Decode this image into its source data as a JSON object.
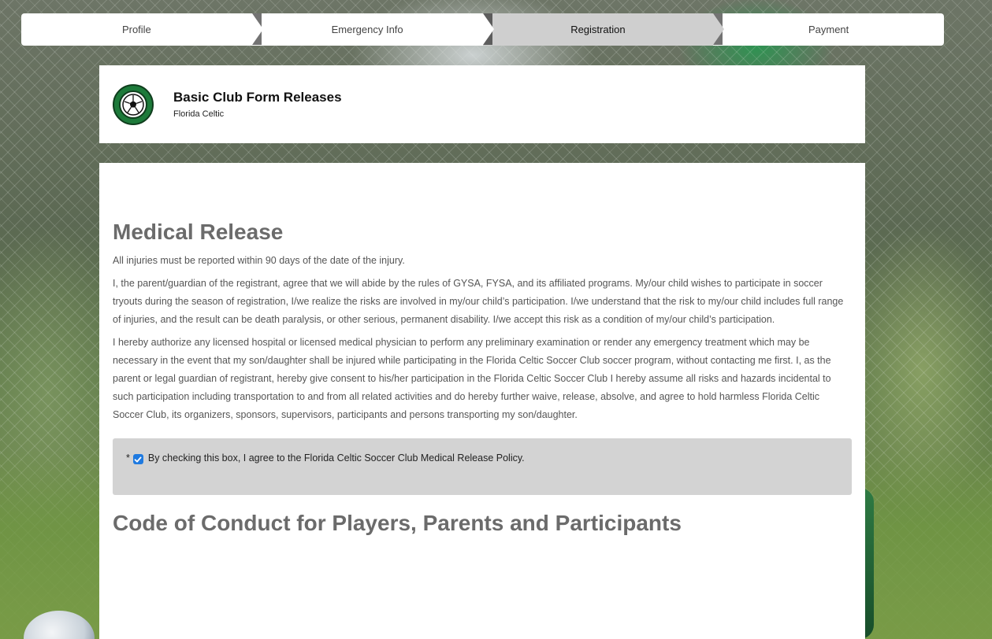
{
  "steps": [
    {
      "label": "Profile",
      "active": false
    },
    {
      "label": "Emergency Info",
      "active": false
    },
    {
      "label": "Registration",
      "active": true
    },
    {
      "label": "Payment",
      "active": false
    }
  ],
  "header": {
    "title": "Basic Club Form Releases",
    "subtitle": "Florida Celtic",
    "logo_text": "FLORIDA CELTIC SOCCER CLUB"
  },
  "medical": {
    "title": "Medical Release",
    "p1": "All injuries must be reported within 90 days of the date of the injury.",
    "p2": "I, the parent/guardian of the registrant, agree that we will abide by the rules of GYSA, FYSA, and its affiliated programs. My/our child wishes to participate in soccer tryouts during the season of registration, I/we realize the risks are involved in my/our child’s participation. I/we understand that the risk to my/our child includes full range of injuries, and the result can be death paralysis, or other serious, permanent disability. I/we accept this risk as a condition of my/our child’s participation.",
    "p3": "I hereby authorize any licensed hospital or licensed medical physician to perform any preliminary examination or render any emergency treatment which may be necessary in the event that my son/daughter shall be injured while participating in the Florida Celtic Soccer Club soccer program, without contacting me first. I, as the parent or legal guardian of registrant, hereby give consent to his/her participation in the Florida Celtic Soccer Club I hereby assume all risks and hazards incidental to such participation including transportation to and from all related activities and do hereby further waive, release, absolve, and agree to hold harmless Florida Celtic Soccer Club, its organizers, sponsors, supervisors, participants and persons transporting my son/daughter.",
    "required_mark": "*",
    "agree_label": "By checking this box, I agree to the Florida Celtic Soccer Club Medical Release Policy.",
    "agree_checked": true
  },
  "conduct": {
    "title": "Code of Conduct for Players, Parents and Participants"
  },
  "colors": {
    "active_step": "#cfcfcf",
    "checkbox": "#1f7ae0",
    "heading": "#6b6b6b",
    "agree_box": "#d3d3d3",
    "logo_green": "#1d7a3a"
  },
  "icons": {
    "logo": "soccer-ball-crest-icon",
    "checkbox": "checkmark-icon"
  }
}
